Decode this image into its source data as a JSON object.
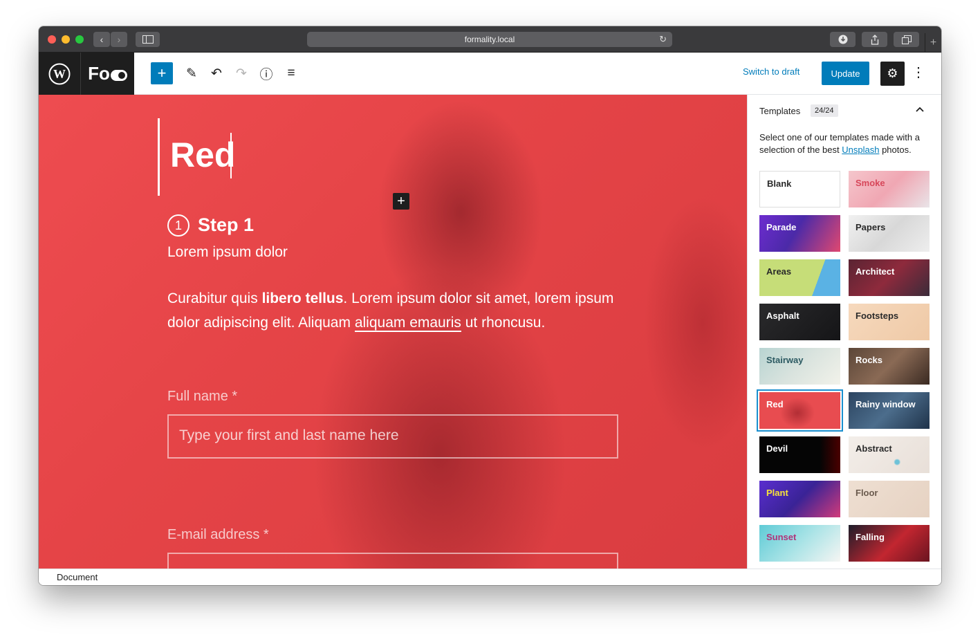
{
  "browser": {
    "url": "formality.local",
    "back_icon": "‹",
    "forward_icon": "›",
    "reload_icon": "↻",
    "new_tab_icon": "+"
  },
  "toolbar": {
    "logo_text": "Fo",
    "add_icon": "+",
    "edit_icon": "✎",
    "undo_icon": "↶",
    "redo_icon": "↷",
    "info_icon": "ⓘ",
    "outline_icon": "≡",
    "switch_to_draft": "Switch to draft",
    "update": "Update",
    "settings_icon": "⚙",
    "more_icon": "⋮"
  },
  "canvas": {
    "title": "Red",
    "inserter_icon": "+",
    "step_number": "1",
    "step_title": "Step 1",
    "step_subtitle": "Lorem ipsum dolor",
    "para_part1": "Curabitur quis ",
    "para_bold": "libero tellus",
    "para_part2": ". Lorem ipsum dolor sit amet, lorem ipsum dolor adipiscing elit. Aliquam ",
    "para_underline": "aliquam emauris",
    "para_part3": " ut rhoncusu.",
    "fields": [
      {
        "label": "Full name *",
        "placeholder": "Type your first and last name here"
      },
      {
        "label": "E-mail address *",
        "placeholder": ""
      }
    ]
  },
  "sidebar": {
    "heading": "Templates",
    "count": "24/24",
    "collapse_icon": "⌃",
    "description_part1": "Select one of our templates made with a selection of the best ",
    "description_link": "Unsplash",
    "description_part2": " photos.",
    "templates": [
      {
        "label": "Blank"
      },
      {
        "label": "Smoke"
      },
      {
        "label": "Parade"
      },
      {
        "label": "Papers"
      },
      {
        "label": "Areas"
      },
      {
        "label": "Architect"
      },
      {
        "label": "Asphalt"
      },
      {
        "label": "Footsteps"
      },
      {
        "label": "Stairway"
      },
      {
        "label": "Rocks"
      },
      {
        "label": "Red"
      },
      {
        "label": "Rainy window"
      },
      {
        "label": "Devil"
      },
      {
        "label": "Abstract"
      },
      {
        "label": "Plant"
      },
      {
        "label": "Floor"
      },
      {
        "label": "Sunset"
      },
      {
        "label": "Falling"
      }
    ],
    "selected_template": "Red"
  },
  "status_bar": {
    "breadcrumb": "Document"
  },
  "colors": {
    "accent": "#007cba",
    "canvas_red": "#e54447",
    "dark": "#1e1e1e"
  }
}
